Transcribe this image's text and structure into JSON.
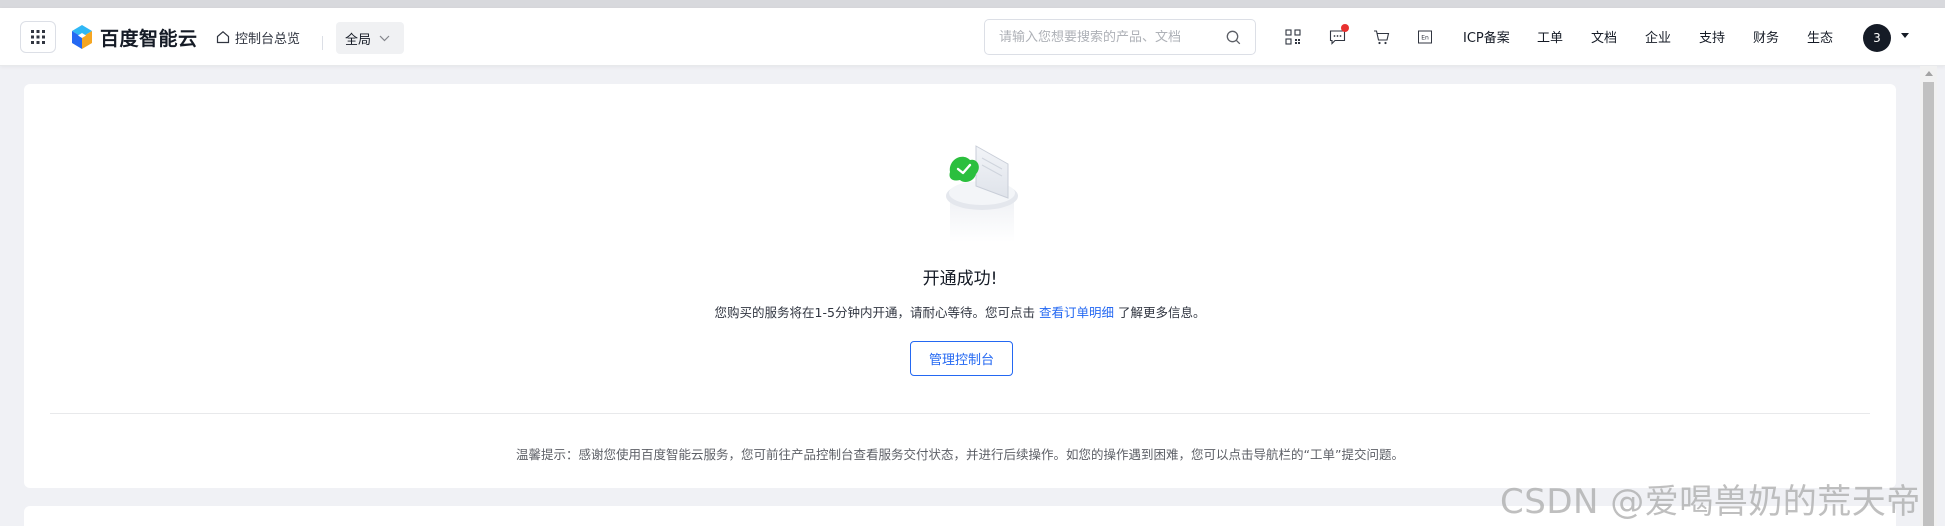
{
  "header": {
    "brand": "百度智能云",
    "overview_label": "控制台总览",
    "region_label": "全局",
    "search_placeholder": "请输入您想要搜索的产品、文档",
    "nav": [
      "ICP备案",
      "工单",
      "文档",
      "企业",
      "支持",
      "财务",
      "生态"
    ],
    "avatar_badge": "3",
    "icons": [
      "apps-grid-icon",
      "brand-logo-icon",
      "home-icon",
      "chevron-down-icon",
      "search-icon",
      "qrcode-icon",
      "message-icon",
      "cart-icon",
      "language-en-icon"
    ],
    "colors": {
      "accent": "#2468f2",
      "notification_dot": "#e8312f"
    }
  },
  "result": {
    "title": "开通成功!",
    "desc_prefix": "您购买的服务将在1-5分钟内开通，请耐心等待。您可点击",
    "desc_link": "查看订单明细",
    "desc_suffix": "了解更多信息。",
    "button_label": "管理控制台",
    "tip": "温馨提示：感谢您使用百度智能云服务，您可前往产品控制台查看服务交付状态，并进行后续操作。如您的操作遇到困难，您可以点击导航栏的“工单”提交问题。"
  },
  "watermark": "CSDN @爱喝兽奶的荒天帝"
}
